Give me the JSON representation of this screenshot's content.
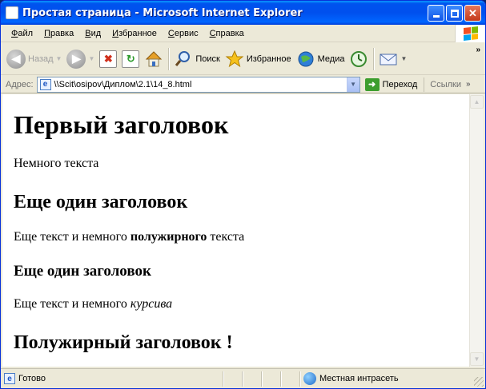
{
  "window": {
    "title": "Простая страница - Microsoft Internet Explorer"
  },
  "menu": {
    "items": [
      "Файл",
      "Правка",
      "Вид",
      "Избранное",
      "Сервис",
      "Справка"
    ]
  },
  "toolbar": {
    "back_label": "Назад",
    "search_label": "Поиск",
    "favorites_label": "Избранное",
    "media_label": "Медиа"
  },
  "address": {
    "label": "Адрес:",
    "url": "\\\\Scit\\osipov\\Диплом\\2.1\\14_8.html",
    "go_label": "Переход",
    "links_label": "Ссылки"
  },
  "content": {
    "h1": "Первый заголовок",
    "p1": "Немного текста",
    "h2": "Еще один заголовок",
    "p2_before": "Еще текст и немного ",
    "p2_bold": "полужирного",
    "p2_after": " текста",
    "h3": "Еще один заголовок",
    "p3_before": "Еще текст и немного ",
    "p3_italic": "курсива",
    "h4": "Полужирный заголовок !"
  },
  "status": {
    "text": "Готово",
    "zone": "Местная интрасеть"
  },
  "colors": {
    "titlebar": "#0053ee",
    "chrome": "#ece9d8",
    "page_bg": "#ffffff"
  }
}
